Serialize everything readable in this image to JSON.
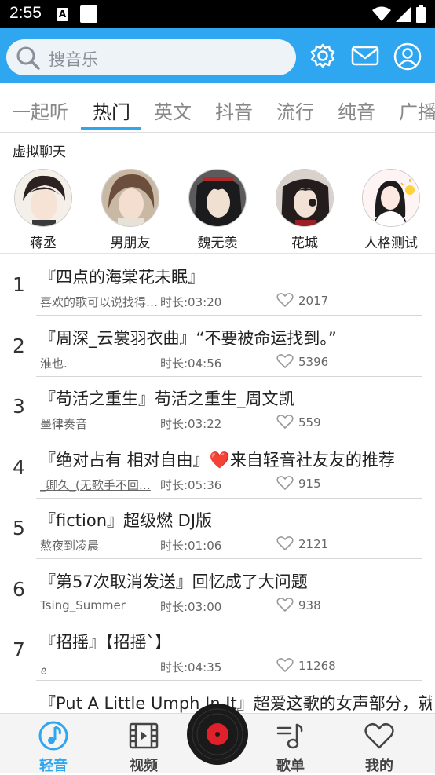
{
  "status": {
    "time": "2:55"
  },
  "search": {
    "placeholder": "搜音乐"
  },
  "tabs": [
    "一起听",
    "热门",
    "英文",
    "抖音",
    "流行",
    "纯音",
    "广播"
  ],
  "active_tab": "热门",
  "virtual_chat": {
    "title": "虚拟聊天",
    "characters": [
      "蒋丞",
      "男朋友",
      "魏无羡",
      "花城",
      "人格测试"
    ]
  },
  "songs": [
    {
      "rank": "1",
      "title": "『四点的海棠花未眠』",
      "artist": "喜欢的歌可以说找得…",
      "duration": "时长:03:20",
      "likes": "2017"
    },
    {
      "rank": "2",
      "title": "『周深_云裳羽衣曲』“不要被命运找到。”",
      "artist": "淮也.",
      "duration": "时长:04:56",
      "likes": "5396"
    },
    {
      "rank": "3",
      "title": "『苟活之重生』苟活之重生_周文凯",
      "artist": "墨律奏音",
      "duration": "时长:03:22",
      "likes": "559"
    },
    {
      "rank": "4",
      "title": "『绝对占有 相对自由』❤️来自轻音社友友的推荐",
      "artist": "_卿久_(无歌手不回…",
      "duration": "时长:05:36",
      "likes": "915"
    },
    {
      "rank": "5",
      "title": "『fiction』超级燃  DJ版",
      "artist": "熬夜到凌晨",
      "duration": "时长:01:06",
      "likes": "2121"
    },
    {
      "rank": "6",
      "title": "『第57次取消发送』回忆成了大问题",
      "artist": "Tsing_Summer",
      "duration": "时长:03:00",
      "likes": "938"
    },
    {
      "rank": "7",
      "title": "『招摇』【招摇`】",
      "artist": "ꫀ",
      "duration": "时长:04:35",
      "likes": "11268"
    },
    {
      "rank": "",
      "title": "『Put A Little Umph In It』超爱这歌的女声部分，就",
      "artist": "",
      "duration": "",
      "likes": ""
    }
  ],
  "bottom_nav": [
    "轻音",
    "视频",
    "歌单",
    "我的"
  ],
  "colors": {
    "accent": "#2ea6f0",
    "status_bar": "#000000",
    "disc_center": "#e0202a"
  }
}
